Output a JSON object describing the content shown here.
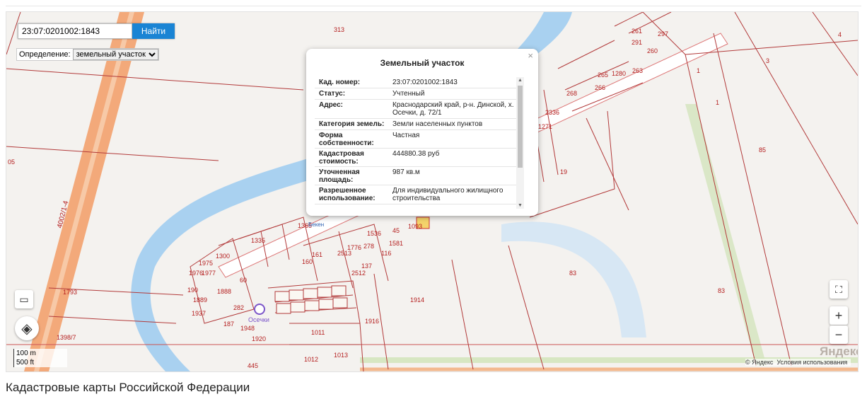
{
  "search": {
    "value": "23:07:0201002:1843",
    "button": "Найти"
  },
  "definition": {
    "label": "Определение:",
    "selected": "земельный участок"
  },
  "popup": {
    "title": "Земельный участок",
    "close": "×",
    "rows": [
      {
        "key": "Кад. номер:",
        "value": "23:07:0201002:1843"
      },
      {
        "key": "Статус:",
        "value": "Учтенный"
      },
      {
        "key": "Адрес:",
        "value": "Краснодарский край, р-н. Динской, х. Осечки, д. 72/1"
      },
      {
        "key": "Категория земель:",
        "value": "Земли населенных пунктов"
      },
      {
        "key": "Форма собственности:",
        "value": "Частная"
      },
      {
        "key": "Кадастровая стоимость:",
        "value": "444880.38 руб"
      },
      {
        "key": "Уточненная площадь:",
        "value": "987 кв.м"
      },
      {
        "key": "Разрешенное использование:",
        "value": "Для индивидуального жилищного строительства"
      }
    ]
  },
  "map": {
    "parcel_labels": [
      "313",
      "4",
      "3",
      "1",
      "1",
      "85",
      "19",
      "83",
      "83",
      "1914",
      "1916",
      "1011",
      "1013",
      "1012",
      "1793",
      "1398/7",
      "1920",
      "1948",
      "187",
      "282",
      "1937",
      "1889",
      "1888",
      "190",
      "1976",
      "1975",
      "1977",
      "1300",
      "1335",
      "1365",
      "445",
      "05",
      "60",
      "161",
      "160",
      "2513",
      "2512",
      "1776",
      "278",
      "1536",
      "1581",
      "116",
      "137",
      "1093",
      "45",
      "268",
      "265",
      "1280",
      "266",
      "2336",
      "1271",
      "291",
      "297",
      "260",
      "261",
      "263"
    ],
    "road_label": "4002/1-4",
    "place_label": "Осечки",
    "place_label_2": "Бекен"
  },
  "controls": {
    "fullscreen": "⛶",
    "zoom_in": "+",
    "zoom_out": "−",
    "ruler": "▭",
    "layers": "◈"
  },
  "scale": {
    "meters": "100 m",
    "feet": "500 ft"
  },
  "attribution": {
    "logo": "Яндекс",
    "copyright": "© Яндекс",
    "terms": "Условия использования"
  },
  "caption": "Кадастровые карты Российской Федерации"
}
